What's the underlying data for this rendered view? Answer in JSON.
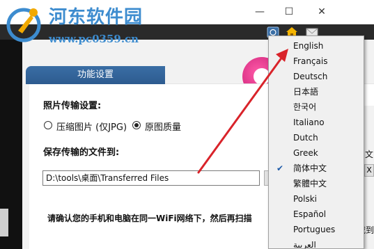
{
  "watermark": {
    "site_name": "河东软件园",
    "url": "www.pc0359.cn"
  },
  "window": {
    "minimize": "—",
    "maximize": "☐",
    "close": "✕"
  },
  "main": {
    "tab_label": "功能设置",
    "photo_section_label": "照片传输设置:",
    "radio_compress": "压缩图片 (仅JPG)",
    "radio_original": "原图质量",
    "radio_selected": "original",
    "save_label": "保存传输的文件到:",
    "save_path": "D:\\tools\\桌面\\Transferred Files",
    "hint": "请确认您的手机和电脑在同一WiFi网络下，然后再扫描",
    "right_edge_fragments": [
      "文",
      "X",
      "载到"
    ]
  },
  "language_menu": {
    "items": [
      {
        "label": "English",
        "checked": false
      },
      {
        "label": "Français",
        "checked": false
      },
      {
        "label": "Deutsch",
        "checked": false
      },
      {
        "label": "日本語",
        "checked": false
      },
      {
        "label": "한국어",
        "checked": false
      },
      {
        "label": "Italiano",
        "checked": false
      },
      {
        "label": "Dutch",
        "checked": false
      },
      {
        "label": "Greek",
        "checked": false
      },
      {
        "label": "简体中文",
        "checked": true
      },
      {
        "label": "繁體中文",
        "checked": false
      },
      {
        "label": "Polski",
        "checked": false
      },
      {
        "label": "Español",
        "checked": false
      },
      {
        "label": "Portugues",
        "checked": false
      },
      {
        "label": "العربية",
        "checked": false
      }
    ]
  },
  "colors": {
    "accent_blue": "#2d5b8f",
    "annotation_arrow": "#d9232a",
    "watermark": "#3d8ccf"
  },
  "icons": [
    "language-icon",
    "home-icon",
    "mail-icon",
    "check-icon"
  ]
}
